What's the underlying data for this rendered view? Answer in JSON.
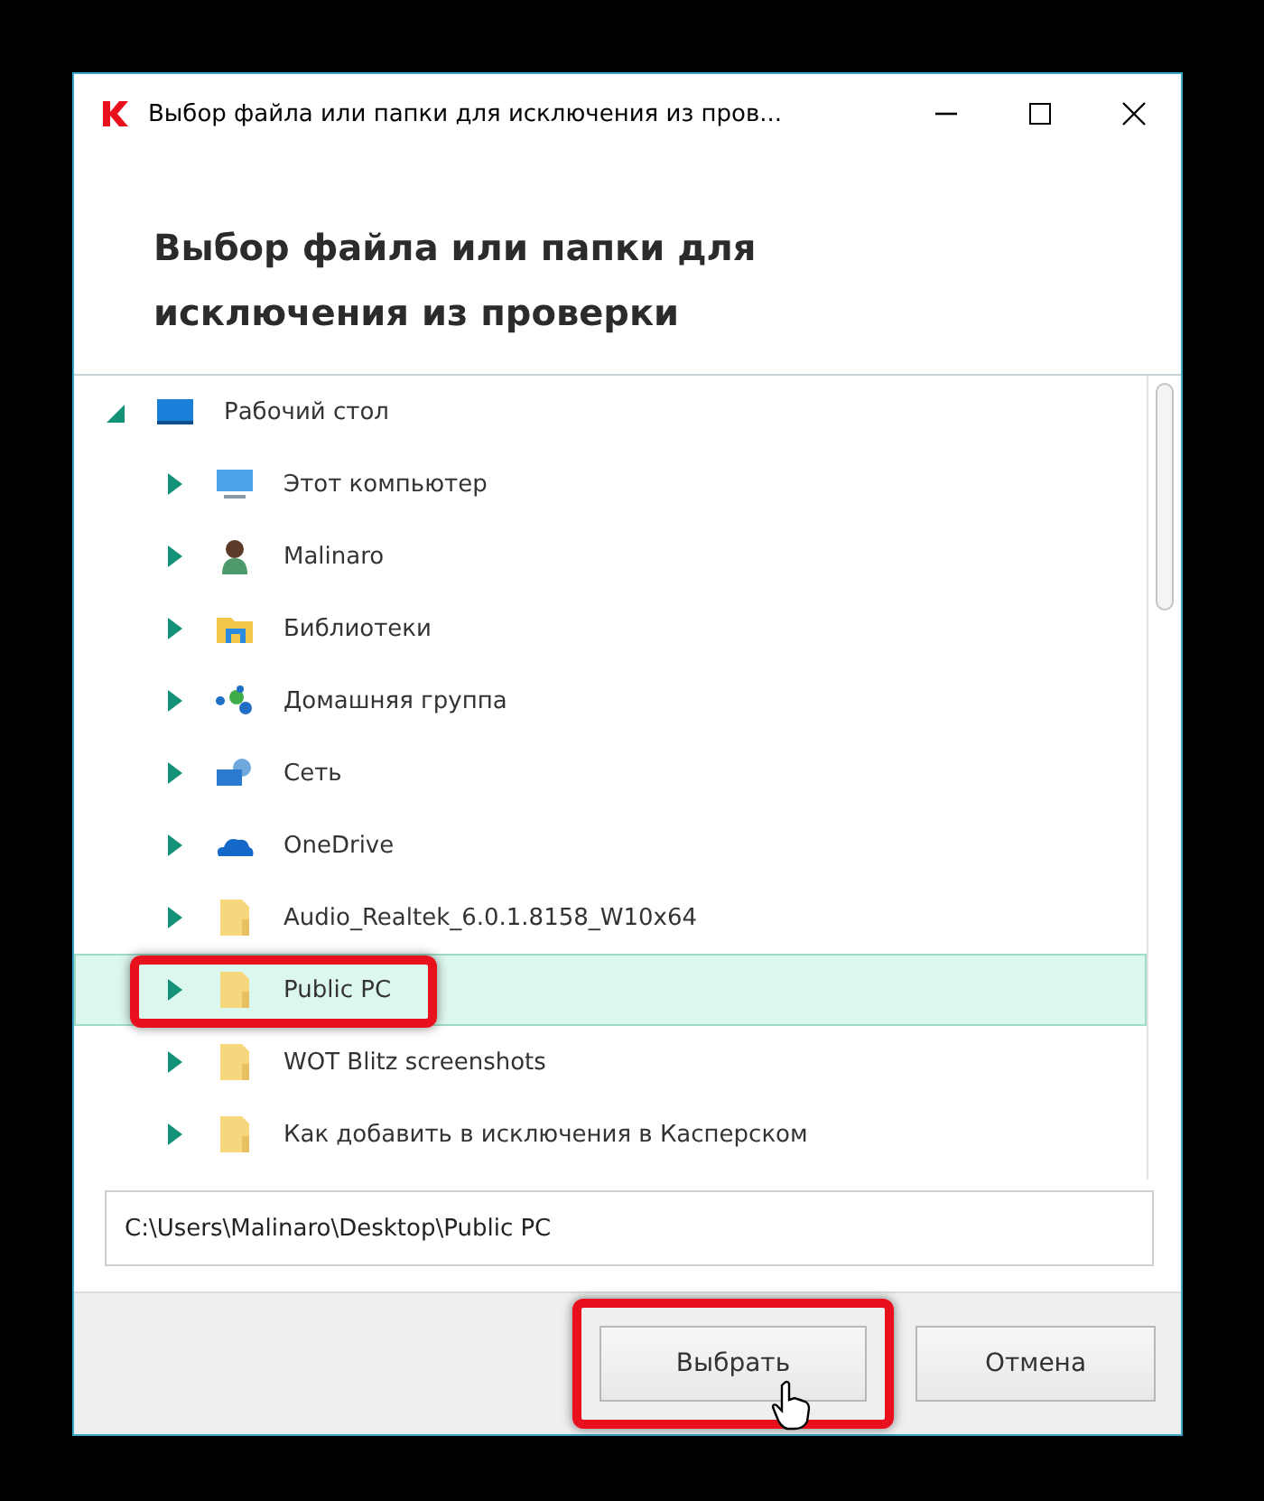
{
  "window": {
    "title": "Выбор файла или папки для исключения из пров..."
  },
  "heading": "Выбор файла или папки для исключения из проверки",
  "tree": {
    "label": "Рабочий стол",
    "kind": "desktop",
    "expanded": true,
    "selected": false,
    "children": [
      {
        "label": "Этот компьютер",
        "kind": "computer",
        "expanded": false,
        "selected": false
      },
      {
        "label": "Malinaro",
        "kind": "user",
        "expanded": false,
        "selected": false
      },
      {
        "label": "Библиотеки",
        "kind": "library",
        "expanded": false,
        "selected": false
      },
      {
        "label": "Домашняя группа",
        "kind": "homegroup",
        "expanded": false,
        "selected": false
      },
      {
        "label": "Сеть",
        "kind": "network",
        "expanded": false,
        "selected": false
      },
      {
        "label": "OneDrive",
        "kind": "onedrive",
        "expanded": false,
        "selected": false
      },
      {
        "label": "Audio_Realtek_6.0.1.8158_W10x64",
        "kind": "folder",
        "expanded": false,
        "selected": false
      },
      {
        "label": "Public PC",
        "kind": "folder",
        "expanded": false,
        "selected": true
      },
      {
        "label": "WOT Blitz screenshots",
        "kind": "folder",
        "expanded": false,
        "selected": false
      },
      {
        "label": "Как добавить в исключения в Касперском",
        "kind": "folder",
        "expanded": false,
        "selected": false
      }
    ]
  },
  "path_field": {
    "value": "C:\\Users\\Malinaro\\Desktop\\Public PC"
  },
  "buttons": [
    {
      "label": "Выбрать",
      "highlighted": true
    },
    {
      "label": "Отмена",
      "highlighted": false
    }
  ]
}
